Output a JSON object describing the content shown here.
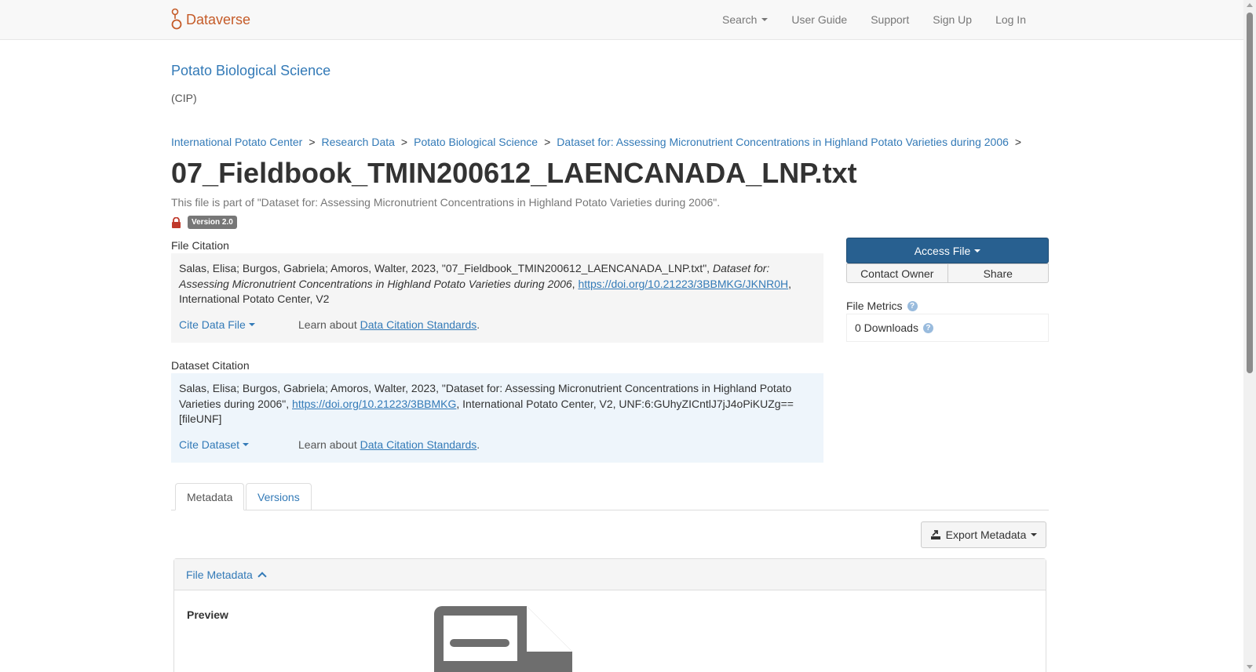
{
  "navbar": {
    "brand": "Dataverse",
    "items": [
      {
        "label": "Search"
      },
      {
        "label": "User Guide"
      },
      {
        "label": "Support"
      },
      {
        "label": "Sign Up"
      },
      {
        "label": "Log In"
      }
    ]
  },
  "dataverse": {
    "name": "Potato Biological Science",
    "affiliation": "(CIP)"
  },
  "breadcrumb": [
    "International Potato Center",
    "Research Data",
    "Potato Biological Science",
    "Dataset for: Assessing Micronutrient Concentrations in Highland Potato Varieties during 2006"
  ],
  "file": {
    "title": "07_Fieldbook_TMIN200612_LAENCANADA_LNP.txt",
    "part_of": "This file is part of \"Dataset for: Assessing Micronutrient Concentrations in Highland Potato Varieties during 2006\".",
    "version": "Version 2.0"
  },
  "file_citation": {
    "label": "File Citation",
    "text_before": "Salas, Elisa; Burgos, Gabriela; Amoros, Walter, 2023, \"07_Fieldbook_TMIN200612_LAENCANADA_LNP.txt\", ",
    "dataset_italic": "Dataset for: Assessing Micronutrient Concentrations in Highland Potato Varieties during 2006",
    "sep": ", ",
    "doi": "https://doi.org/10.21223/3BBMKG/JKNR0H",
    "text_after": ", International Potato Center, V2",
    "cite_button": "Cite Data File",
    "learn_prefix": "Learn about ",
    "learn_link": "Data Citation Standards",
    "learn_suffix": "."
  },
  "dataset_citation": {
    "label": "Dataset Citation",
    "text_before": "Salas, Elisa; Burgos, Gabriela; Amoros, Walter, 2023, \"Dataset for: Assessing Micronutrient Concentrations in Highland Potato Varieties during 2006\", ",
    "doi": "https://doi.org/10.21223/3BBMKG",
    "text_after": ", International Potato Center, V2, UNF:6:GUhyZICntlJ7jJ4oPiKUZg== [fileUNF]",
    "cite_button": "Cite Dataset",
    "learn_prefix": "Learn about ",
    "learn_link": "Data Citation Standards",
    "learn_suffix": "."
  },
  "sidebar": {
    "access_file": "Access File",
    "contact_owner": "Contact Owner",
    "share": "Share",
    "metrics_title": "File Metrics",
    "downloads": "0 Downloads"
  },
  "tabs": {
    "metadata": "Metadata",
    "versions": "Versions"
  },
  "export_metadata": "Export Metadata",
  "file_metadata": {
    "heading": "File Metadata",
    "preview_label": "Preview"
  },
  "colors": {
    "brand": "#c55b28",
    "link": "#337ab7",
    "primary_button": "#286090",
    "lock": "#c0392b"
  }
}
